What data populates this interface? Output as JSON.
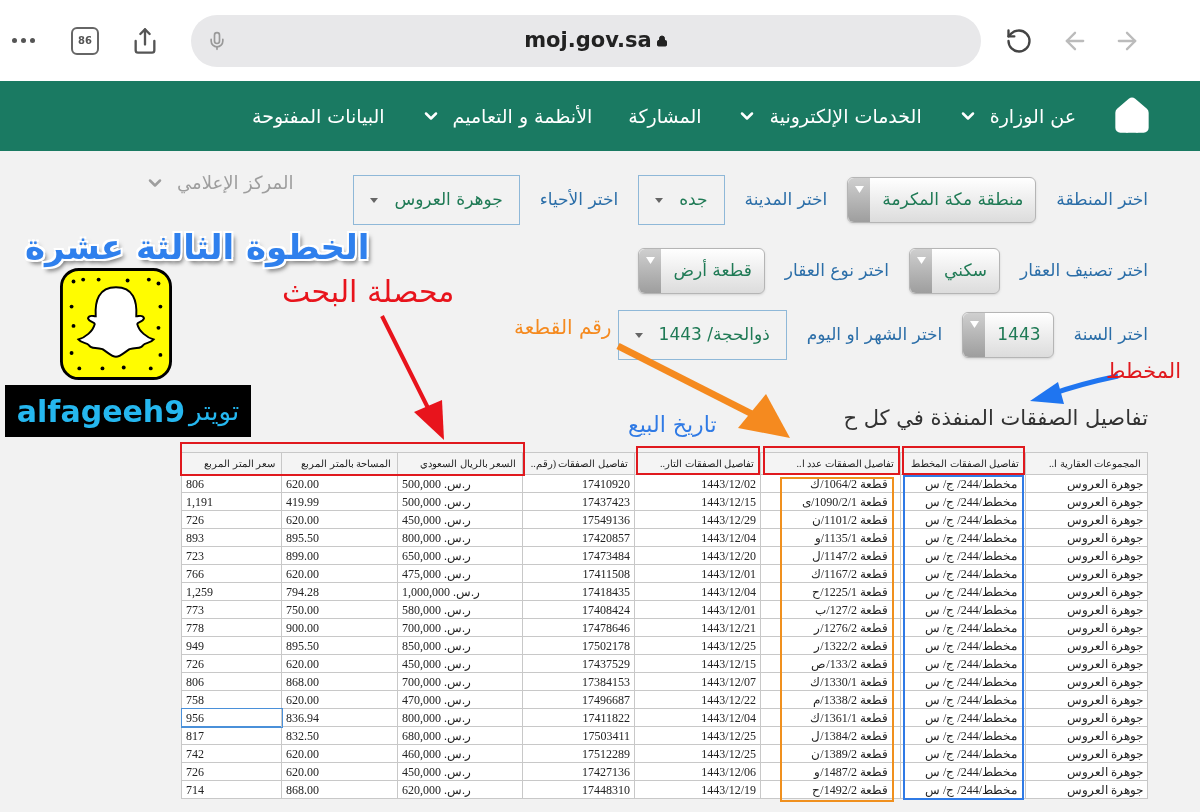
{
  "browser": {
    "tab_count": "86",
    "url": "moj.gov.sa"
  },
  "nav": {
    "items": [
      {
        "label": "عن الوزارة",
        "has_caret": true
      },
      {
        "label": "الخدمات الإلكترونية",
        "has_caret": true
      },
      {
        "label": "المشاركة",
        "has_caret": false
      },
      {
        "label": "الأنظمة و التعاميم",
        "has_caret": true
      },
      {
        "label": "البيانات المفتوحة",
        "has_caret": false
      }
    ],
    "overflow_item": {
      "label": "المركز الإعلامي",
      "has_caret": true
    }
  },
  "filters": [
    [
      {
        "label": "اختر المنطقة",
        "value": "منطقة مكة المكرمة",
        "kind": "gradient"
      },
      {
        "label": "اختر المدينة",
        "value": "جده",
        "kind": "plain"
      },
      {
        "label": "اختر الأحياء",
        "value": "جوهرة العروس",
        "kind": "plain"
      }
    ],
    [
      {
        "label": "اختر تصنيف العقار",
        "value": "سكني",
        "kind": "gradient"
      },
      {
        "label": "اختر نوع العقار",
        "value": "قطعة أرض",
        "kind": "gradient"
      }
    ],
    [
      {
        "label": "اختر السنة",
        "value": "1443",
        "kind": "gradient"
      },
      {
        "label": "اختر الشهر او اليوم",
        "value": "ذوالحجة/ 1443",
        "kind": "plain"
      }
    ]
  ],
  "heading": "تفاصيل الصفقات المنفذة في كل ح",
  "table": {
    "columns": [
      "المجموعات العقارية ا..",
      "تفاصيل الصفقات المخطط",
      "تفاصيل الصفقات عدد ا..",
      "تفاصيل الصفقات التار..",
      "تفاصيل الصفقات (رقم..",
      "السعر بالريال السعودي",
      "المساحة بالمتر المربع",
      "سعر المتر المربع"
    ],
    "rows": [
      {
        "selected": false,
        "cells": [
          "جوهرة العروس",
          "مخطط/244/ ج/ س",
          "قطعة 1064/2/ك",
          "1443/12/02",
          "17410920",
          "ر.س. 500,000",
          "620.00",
          "806"
        ]
      },
      {
        "selected": false,
        "cells": [
          "جوهرة العروس",
          "مخطط/244/ ج/ س",
          "قطعة 1090/2/1/ى",
          "1443/12/15",
          "17437423",
          "ر.س. 500,000",
          "419.99",
          "1,191"
        ]
      },
      {
        "selected": false,
        "cells": [
          "جوهرة العروس",
          "مخطط/244/ ج/ س",
          "قطعة 1101/2/ن",
          "1443/12/29",
          "17549136",
          "ر.س. 450,000",
          "620.00",
          "726"
        ]
      },
      {
        "selected": false,
        "cells": [
          "جوهرة العروس",
          "مخطط/244/ ج/ س",
          "قطعة 1135/1/و",
          "1443/12/04",
          "17420857",
          "ر.س. 800,000",
          "895.50",
          "893"
        ]
      },
      {
        "selected": false,
        "cells": [
          "جوهرة العروس",
          "مخطط/244/ ج/ س",
          "قطعة 1147/2/ل",
          "1443/12/20",
          "17473484",
          "ر.س. 650,000",
          "899.00",
          "723"
        ]
      },
      {
        "selected": false,
        "cells": [
          "جوهرة العروس",
          "مخطط/244/ ج/ س",
          "قطعة 1167/2/ك",
          "1443/12/01",
          "17411508",
          "ر.س. 475,000",
          "620.00",
          "766"
        ]
      },
      {
        "selected": false,
        "cells": [
          "جوهرة العروس",
          "مخطط/244/ ج/ س",
          "قطعة 1225/1/ح",
          "1443/12/04",
          "17418435",
          "ر.س. 1,000,000",
          "794.28",
          "1,259"
        ]
      },
      {
        "selected": false,
        "cells": [
          "جوهرة العروس",
          "مخطط/244/ ج/ س",
          "قطعة 127/2/ب",
          "1443/12/01",
          "17408424",
          "ر.س. 580,000",
          "750.00",
          "773"
        ]
      },
      {
        "selected": false,
        "cells": [
          "جوهرة العروس",
          "مخطط/244/ ج/ س",
          "قطعة 1276/2/ر",
          "1443/12/21",
          "17478646",
          "ر.س. 700,000",
          "900.00",
          "778"
        ]
      },
      {
        "selected": false,
        "cells": [
          "جوهرة العروس",
          "مخطط/244/ ج/ س",
          "قطعة 1322/2/ر",
          "1443/12/25",
          "17502178",
          "ر.س. 850,000",
          "895.50",
          "949"
        ]
      },
      {
        "selected": false,
        "cells": [
          "جوهرة العروس",
          "مخطط/244/ ج/ س",
          "قطعة 133/2/ص",
          "1443/12/15",
          "17437529",
          "ر.س. 450,000",
          "620.00",
          "726"
        ]
      },
      {
        "selected": false,
        "cells": [
          "جوهرة العروس",
          "مخطط/244/ ج/ س",
          "قطعة 1330/1/ك",
          "1443/12/07",
          "17384153",
          "ر.س. 700,000",
          "868.00",
          "806"
        ]
      },
      {
        "selected": false,
        "cells": [
          "جوهرة العروس",
          "مخطط/244/ ج/ س",
          "قطعة 1338/2/م",
          "1443/12/22",
          "17496687",
          "ر.س. 470,000",
          "620.00",
          "758"
        ]
      },
      {
        "selected": true,
        "cells": [
          "جوهرة العروس",
          "مخطط/244/ ج/ س",
          "قطعة 1361/1/ك",
          "1443/12/04",
          "17411822",
          "ر.س. 800,000",
          "836.94",
          "956"
        ]
      },
      {
        "selected": false,
        "cells": [
          "جوهرة العروس",
          "مخطط/244/ ج/ س",
          "قطعة 1384/2/ل",
          "1443/12/25",
          "17503411",
          "ر.س. 680,000",
          "832.50",
          "817"
        ]
      },
      {
        "selected": false,
        "cells": [
          "جوهرة العروس",
          "مخطط/244/ ج/ س",
          "قطعة 1389/2/ن",
          "1443/12/25",
          "17512289",
          "ر.س. 460,000",
          "620.00",
          "742"
        ]
      },
      {
        "selected": false,
        "cells": [
          "جوهرة العروس",
          "مخطط/244/ ج/ س",
          "قطعة 1487/2/و",
          "1443/12/06",
          "17427136",
          "ر.س. 450,000",
          "620.00",
          "726"
        ]
      },
      {
        "selected": false,
        "cells": [
          "جوهرة العروس",
          "مخطط/244/ ج/ س",
          "قطعة 1492/2/ح",
          "1443/12/19",
          "17448310",
          "ر.س. 620,000",
          "868.00",
          "714"
        ]
      }
    ]
  },
  "annotations": {
    "step_title": "الخطوة الثالثة عشرة",
    "search_result": "محصلة البحث",
    "plot_number": "رقم القطعة",
    "sale_date": "تاريخ البيع",
    "plan": "المخطط",
    "twitter_label": "تويتر",
    "twitter_handle": "alfageeh9"
  }
}
